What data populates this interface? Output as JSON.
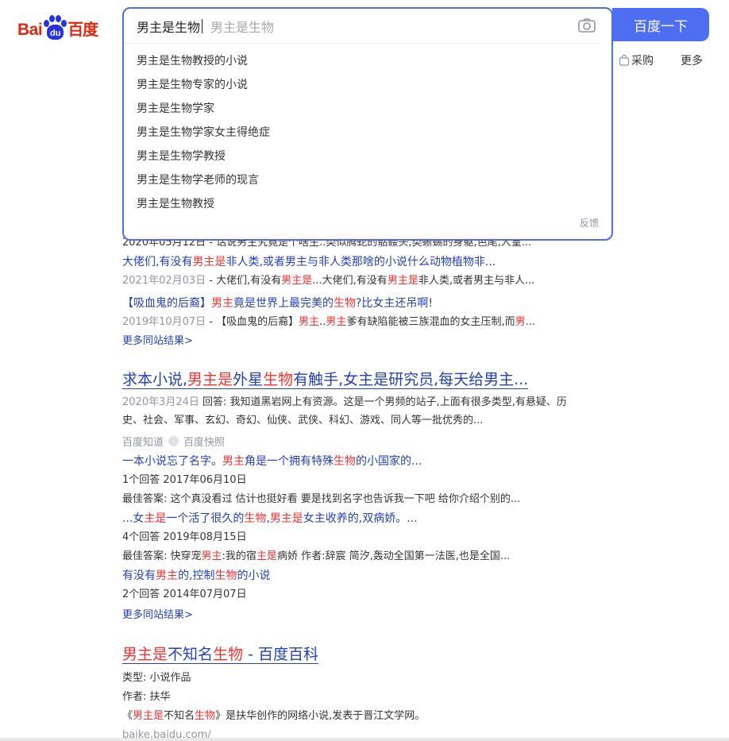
{
  "logo": {
    "bai": "Bai",
    "du": "du",
    "baidu_cn": "百度"
  },
  "search": {
    "query": "男主是生物",
    "ghost": "男主是生物",
    "button": "百度一下",
    "suggestions": [
      "男主是生物教授的小说",
      "男主是生物专家的小说",
      "男主是生物学家",
      "男主是生物学家女主得绝症",
      "男主是生物学教授",
      "男主是生物学老师的现言",
      "男主是生物教授"
    ],
    "feedback": "反馈"
  },
  "nav": {
    "caigou": "采购",
    "more": "更多"
  },
  "result1": {
    "partial_meta": "2020年05月12日 - 话说男主究竟是个啥生..类似腾蛇的骷髅头,类蜥蜴的身躯,笆尾,人皇...",
    "sub": [
      {
        "title_pre": "大佬们,有没有",
        "title_em": "男主是",
        "title_post": "非人类,或者男主与非人类那啥的小说什么动物植物非...",
        "date": "2021年02月03日",
        "desc_pre": " - 大佬们,有没有",
        "desc_em1": "男主是",
        "desc_mid": "...大佬们,有没有",
        "desc_em2": "男主是",
        "desc_post": "非人类,或者男主与非人..."
      },
      {
        "title_pre": "【吸血鬼的后裔】",
        "title_em": "男主",
        "title_mid": "竟是世界上最完美的",
        "title_em2": "生物",
        "title_post": "?比女主还吊啊!",
        "date": "2019年10月07日",
        "desc_pre": " - 【吸血鬼的后裔】",
        "desc_em1": "男主",
        "desc_mid": "..",
        "desc_em2": "男主",
        "desc_post": "爹有缺陷能被三族混血的女主压制,而",
        "desc_em3": "男",
        "desc_end": "..."
      }
    ],
    "more": "更多同站结果>"
  },
  "result2": {
    "title_pre": "求本小说,",
    "title_em1": "男主是",
    "title_mid1": "外星",
    "title_em2": "生物",
    "title_post": "有触手,女主是研究员,每天给男主...",
    "date": "2020年3月24日",
    "desc1": "回答: 我知道黑岩网上有资源。这是一个男频的站子,上面有很多类型,有悬疑、历",
    "desc2": "史、社会、军事、玄幻、奇幻、仙侠、武侠、科幻、游戏、同人等一批优秀的...",
    "source": "百度知道",
    "snapshot": "百度快照",
    "qa": [
      {
        "q_pre": "一本小说忘了名字。",
        "q_em1": "男主",
        "q_mid": "角是一个拥有特殊",
        "q_em2": "生物",
        "q_post": "的小国家的...",
        "meta": "1个回答   2017年06月10日",
        "ans": "最佳答案: 这个真没看过 估计也挺好看 要是找到名字也告诉我一下吧 给你介绍个别的..."
      },
      {
        "q_pre": "...女",
        "q_em1": "主是",
        "q_mid": "一个活了很久的",
        "q_em2": "生物",
        "q_mid2": ",",
        "q_em3": "男主是",
        "q_post": "女主收养的,双病娇。...",
        "meta": "4个回答   2019年08月15日",
        "ans_pre": "最佳答案: 快穿宠",
        "ans_em1": "男主",
        "ans_mid": ":我的宿",
        "ans_em2": "主是",
        "ans_post": "病娇 作者:辞宸 简汐,轰动全国第一法医,也是全国..."
      },
      {
        "q_pre": "有没有",
        "q_em1": "男主",
        "q_mid": "的,控制",
        "q_em2": "生物",
        "q_post": "的小说",
        "meta": "2个回答   2014年07月07日"
      }
    ],
    "more": "更多同站结果>"
  },
  "result3": {
    "title_em1": "男主是",
    "title_mid": "不知名",
    "title_em2": "生物",
    "title_post": " - 百度百科",
    "type": "类型: 小说作品",
    "author": "作者: 扶华",
    "desc_pre": "《",
    "desc_em1": "男主是",
    "desc_mid": "不知名",
    "desc_em2": "生物",
    "desc_post": "》是扶华创作的网络小说,发表于晋江文学网。",
    "url": "baike.baidu.com/"
  }
}
